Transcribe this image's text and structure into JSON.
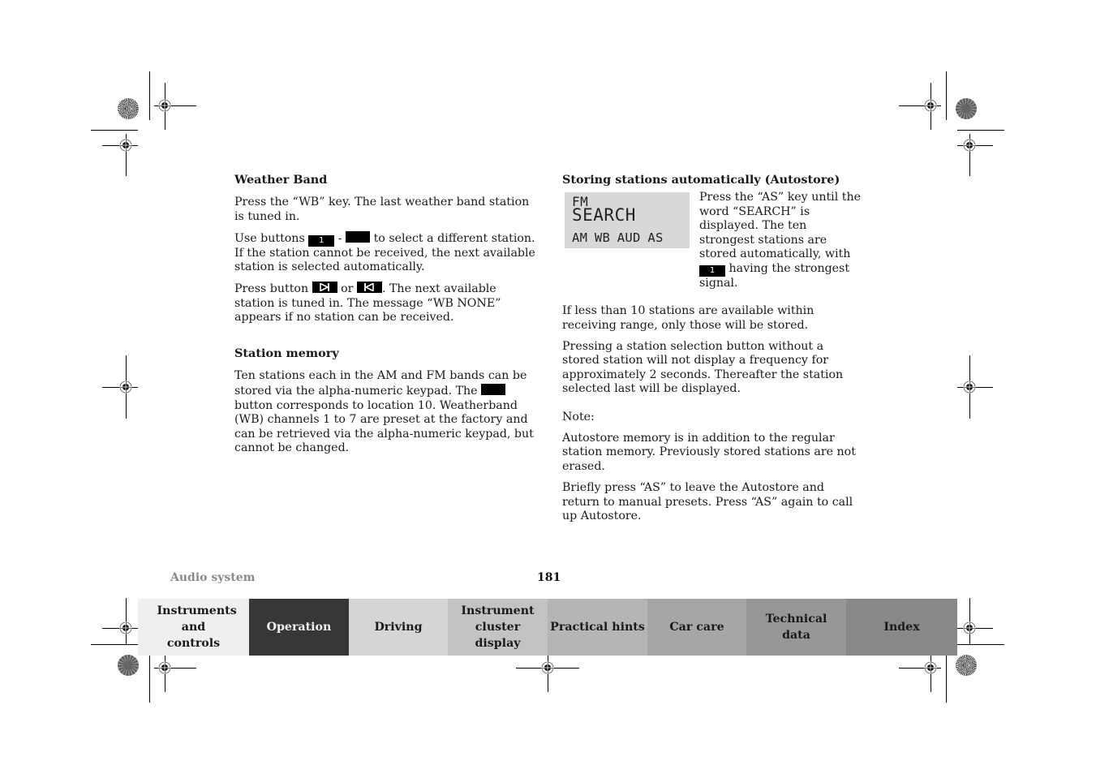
{
  "left_column": {
    "weather_band": {
      "heading": "Weather Band",
      "p1": "Press the “WB” key. The last weather band station is tuned in.",
      "p2_a": "Use buttons ",
      "p2_key1": "1",
      "p2_dash": " - ",
      "p2_b": " to select a different station. If the station cannot be received, the next available station is selected automatically.",
      "p3_a": "Press button ",
      "p3_or": " or ",
      "p3_b": ". The next available station is tuned in. The message “WB NONE” appears if no station can be received."
    },
    "station_memory": {
      "heading": "Station memory",
      "p1_a": "Ten stations each in the AM and FM bands can be stored via the alpha-numeric keypad. The ",
      "p1_b": " button corresponds to location 10. Weatherband (WB) channels 1 to 7 are preset at the factory and can be retrieved via the alpha-numeric keypad, but cannot be changed."
    }
  },
  "right_column": {
    "heading": "Storing stations automatically (Autostore)",
    "lcd": {
      "line1": "FM",
      "line2": "SEARCH",
      "line3": "AM WB AUD AS"
    },
    "lcd_text_a": "Press the “AS” key until the word “SEARCH” is displayed. The ten strongest stations are stored automatically, with ",
    "lcd_text_key": "1",
    "lcd_text_b": " having the strongest signal.",
    "p1": "If less than 10 stations are available within receiving range, only those will be stored.",
    "p2": "Pressing a station selection button without a stored station will not display a frequency for approximately 2 seconds. Thereafter the station selected last will be displayed.",
    "note_label": "Note:",
    "p3": "Autostore memory is in addition to the regular station memory. Previously stored stations are not erased.",
    "p4": "Briefly press “AS” to leave the Autostore and return to manual presets. Press “AS” again to call up Autostore."
  },
  "footer": {
    "section": "Audio system",
    "page_number": "181"
  },
  "tabs": [
    {
      "label": "Instruments and controls",
      "active": false
    },
    {
      "label": "Operation",
      "active": true
    },
    {
      "label": "Driving",
      "active": false
    },
    {
      "label": "Instrument cluster display",
      "active": false
    },
    {
      "label": "Practical hints",
      "active": false
    },
    {
      "label": "Car care",
      "active": false
    },
    {
      "label": "Technical data",
      "active": false
    },
    {
      "label": "Index",
      "active": false
    }
  ],
  "icons": {
    "seek_forward": "skip-forward-icon",
    "seek_back": "skip-back-icon",
    "registration_mark": "crosshair-target-icon",
    "color_rosette": "rosette-icon"
  }
}
